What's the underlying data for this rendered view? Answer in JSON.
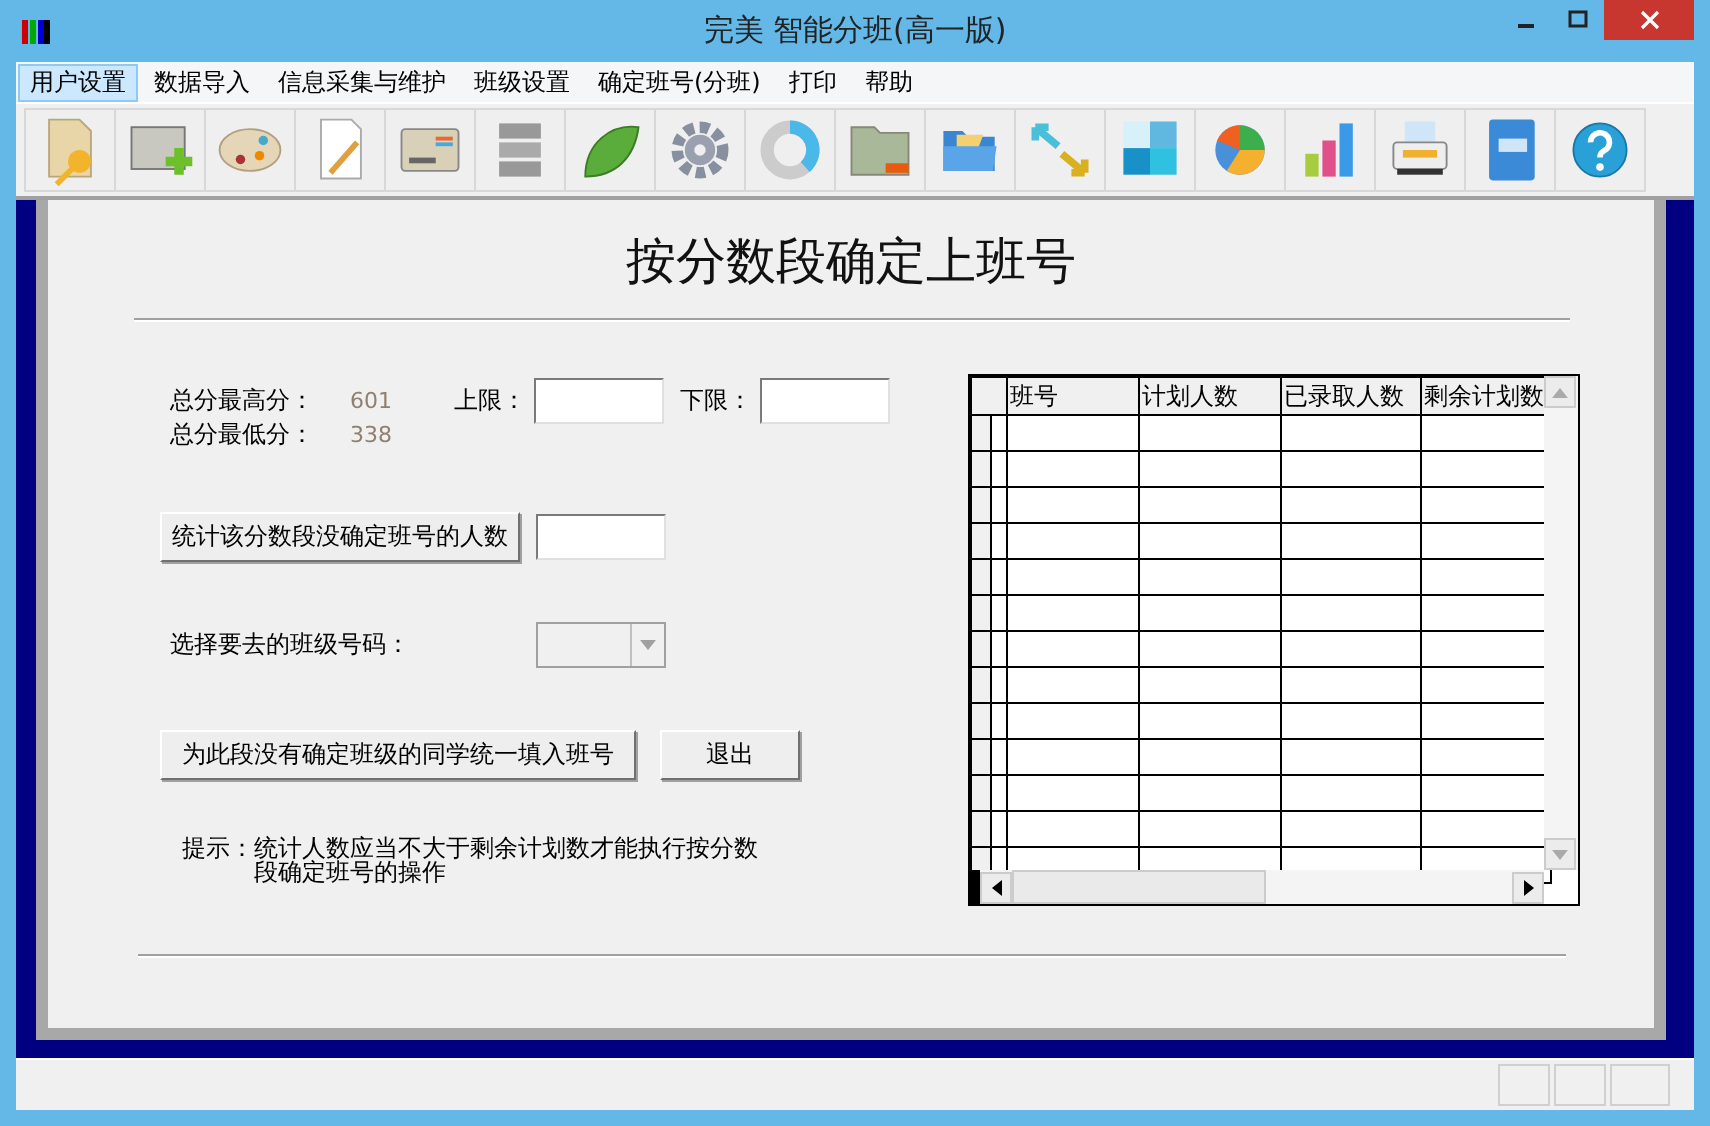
{
  "window": {
    "title": "完美 智能分班(高一版)"
  },
  "menu": [
    {
      "label": "用户设置",
      "selected": true
    },
    {
      "label": "数据导入",
      "selected": false
    },
    {
      "label": "信息采集与维护",
      "selected": false
    },
    {
      "label": "班级设置",
      "selected": false
    },
    {
      "label": "确定班号(分班)",
      "selected": false
    },
    {
      "label": "打印",
      "selected": false
    },
    {
      "label": "帮助",
      "selected": false
    }
  ],
  "form": {
    "heading": "按分数段确定上班号",
    "max_label": "总分最高分：",
    "max_value": "601",
    "min_label": "总分最低分：",
    "min_value": "338",
    "upper_label": "上限：",
    "lower_label": "下限：",
    "count_button": "统计该分数段没确定班号的人数",
    "class_label": "选择要去的班级号码：",
    "class_select": {
      "disabled": true
    },
    "fill_button": "为此段没有确定班级的同学统一填入班号",
    "exit_button": "退出",
    "hint_label": "提示：",
    "hint": "统计人数应当不大于剩余计划数才能执行按分数段确定班号的操作"
  },
  "table": {
    "columns": [
      "班号",
      "计划人数",
      "已录取人数",
      "剩余计划数"
    ]
  }
}
